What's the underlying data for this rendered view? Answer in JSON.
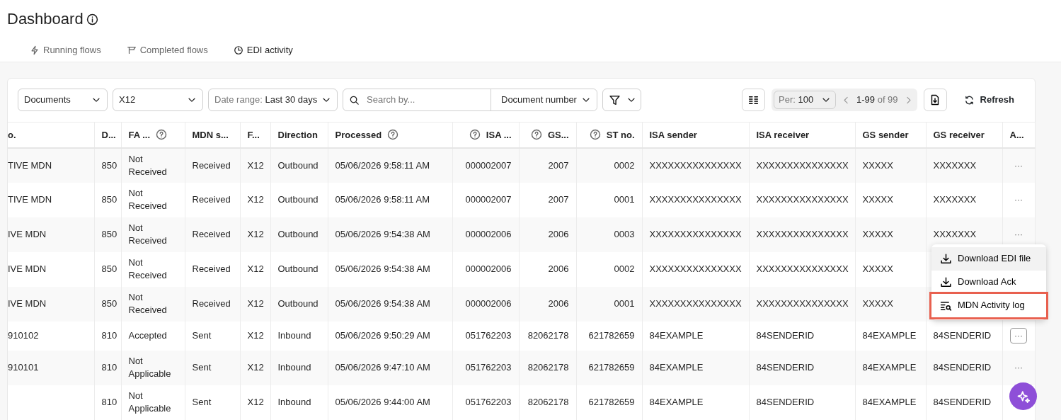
{
  "page": {
    "title": "Dashboard"
  },
  "tabs": [
    {
      "label": "Running flows",
      "selected": false
    },
    {
      "label": "Completed flows",
      "selected": false
    },
    {
      "label": "EDI activity",
      "selected": true
    }
  ],
  "toolbar": {
    "document_type": "Documents",
    "standard": "X12",
    "date_range": {
      "label": "Date range:",
      "value": "Last 30 days"
    },
    "search": {
      "placeholder": "Search by...",
      "field": "Document number"
    },
    "per_page": {
      "label": "Per:",
      "value": "100"
    },
    "range": "1-99",
    "total": "of 99",
    "refresh": "Refresh"
  },
  "table": {
    "columns": [
      {
        "label": "o."
      },
      {
        "label": "D..."
      },
      {
        "label": "FA ..."
      },
      {
        "label": "MDN s..."
      },
      {
        "label": "F..."
      },
      {
        "label": "Direction"
      },
      {
        "label": "Processed"
      },
      {
        "label": "ISA ..."
      },
      {
        "label": "GS..."
      },
      {
        "label": "ST no."
      },
      {
        "label": "ISA sender"
      },
      {
        "label": "ISA receiver"
      },
      {
        "label": "GS sender"
      },
      {
        "label": "GS receiver"
      },
      {
        "label": "A..."
      }
    ],
    "rows": [
      {
        "cells": [
          "TIVE MDN",
          "850",
          "Not Received",
          "Received",
          "X12",
          "Outbound",
          "05/06/2026 9:58:11 AM",
          "000002007",
          "2007",
          "0002",
          "XXXXXXXXXXXXXXX",
          "XXXXXXXXXXXXXXX",
          "XXXXX",
          "XXXXXXX"
        ],
        "actions": "···",
        "menu_open": false
      },
      {
        "cells": [
          "TIVE MDN",
          "850",
          "Not Received",
          "Received",
          "X12",
          "Outbound",
          "05/06/2026 9:58:11 AM",
          "000002007",
          "2007",
          "0001",
          "XXXXXXXXXXXXXXX",
          "XXXXXXXXXXXXXXX",
          "XXXXX",
          "XXXXXXX"
        ],
        "actions": "···",
        "menu_open": false
      },
      {
        "cells": [
          "IVE MDN",
          "850",
          "Not Received",
          "Received",
          "X12",
          "Outbound",
          "05/06/2026 9:54:38 AM",
          "000002006",
          "2006",
          "0003",
          "XXXXXXXXXXXXXXX",
          "XXXXXXXXXXXXXXX",
          "XXXXX",
          "XXXXXXX"
        ],
        "actions": "···",
        "menu_open": false
      },
      {
        "cells": [
          "IVE MDN",
          "850",
          "Not Received",
          "Received",
          "X12",
          "Outbound",
          "05/06/2026 9:54:38 AM",
          "000002006",
          "2006",
          "0002",
          "XXXXXXXXXXXXXXX",
          "XXXXXXXXXXXXXXX",
          "XXXXX"
        ],
        "menu_open": false
      },
      {
        "cells": [
          "IVE MDN",
          "850",
          "Not Received",
          "Received",
          "X12",
          "Outbound",
          "05/06/2026 9:54:38 AM",
          "000002006",
          "2006",
          "0001",
          "XXXXXXXXXXXXXXX",
          "XXXXXXXXXXXXXXX",
          "XXXXX"
        ],
        "menu_open": false
      },
      {
        "cells": [
          "910102",
          "810",
          "Accepted",
          "Sent",
          "X12",
          "Inbound",
          "05/06/2026 9:50:29 AM",
          "051762203",
          "82062178",
          "621782659",
          "84EXAMPLE",
          "84SENDERID",
          "84EXAMPLE",
          "84SENDERID"
        ],
        "actions": "···",
        "menu_open": true
      },
      {
        "cells": [
          "910101",
          "810",
          "Not Applicable",
          "Sent",
          "X12",
          "Inbound",
          "05/06/2026 9:47:10 AM",
          "051762203",
          "82062178",
          "621782659",
          "84EXAMPLE",
          "84SENDERID",
          "84EXAMPLE",
          "84SENDERID"
        ],
        "actions": "···",
        "menu_open": false
      },
      {
        "cells": [
          null,
          "810",
          "Not Applicable",
          "Sent",
          "X12",
          "Inbound",
          "05/06/2026 9:44:00 AM",
          "051762203",
          "82062178",
          "621782659",
          "84EXAMPLE",
          "84SENDERID",
          "84EXAMPLE",
          "84SENDERID"
        ],
        "menu_open": false
      }
    ]
  },
  "row_menu": {
    "items": [
      {
        "label": "Download EDI file",
        "highlighted": true,
        "outlined": false
      },
      {
        "label": "Download Ack",
        "highlighted": false,
        "outlined": false
      },
      {
        "label": "MDN Activity log",
        "highlighted": false,
        "outlined": true
      }
    ]
  }
}
